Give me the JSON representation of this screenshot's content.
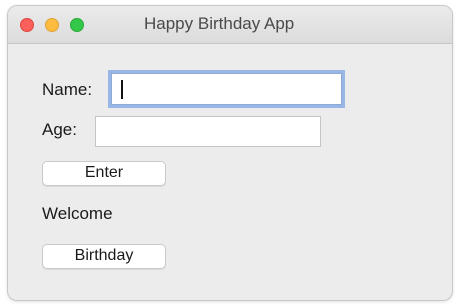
{
  "window": {
    "title": "Happy Birthday App"
  },
  "form": {
    "name_label": "Name:",
    "name_value": "",
    "age_label": "Age:",
    "age_value": "",
    "enter_label": "Enter",
    "welcome_text": "Welcome",
    "birthday_label": "Birthday"
  },
  "colors": {
    "window_bg": "#ececec",
    "focus_ring": "#98b6e6",
    "close": "#fc605c",
    "minimize": "#fdbc40",
    "maximize": "#34c84a"
  }
}
